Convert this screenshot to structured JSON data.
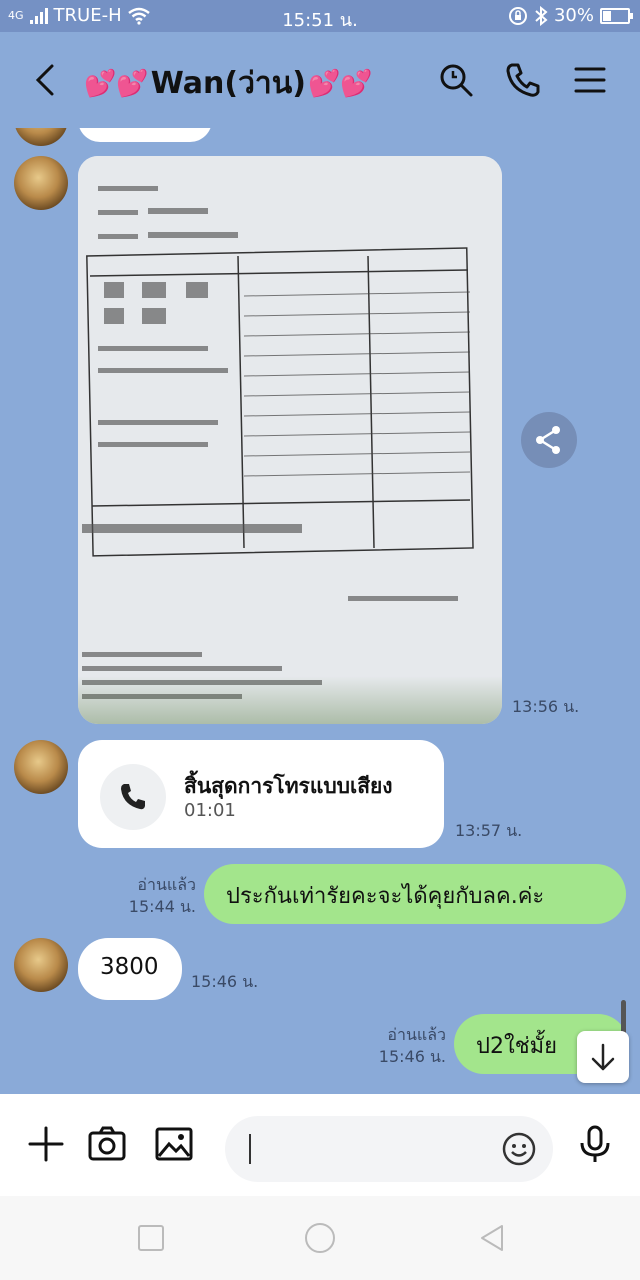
{
  "status_bar": {
    "network": "4G",
    "carrier": "TRUE-H",
    "time": "15:51 น.",
    "battery": "30%"
  },
  "header": {
    "contact_name": "Wan(ว่าน)",
    "back_icon": "chevron-left-icon",
    "search_icon": "search-icon",
    "call_icon": "phone-icon",
    "menu_icon": "menu-icon",
    "heart_color": "#e8508c"
  },
  "messages": [
    {
      "type": "image",
      "sender": "contact",
      "content": "photo of a car purchase commission document",
      "time": "13:56 น."
    },
    {
      "type": "call",
      "sender": "contact",
      "title": "สิ้นสุดการโทรแบบเสียง",
      "duration": "01:01",
      "time": "13:57 น."
    },
    {
      "type": "text",
      "sender": "me",
      "text": "ประกันเท่ารัยคะจะได้คุยกับลค.ค่ะ",
      "read_label": "อ่านแล้ว",
      "time": "15:44 น."
    },
    {
      "type": "text",
      "sender": "contact",
      "text": "3800",
      "time": "15:46 น."
    },
    {
      "type": "text",
      "sender": "me",
      "text": "ป2ใช่มั้ย",
      "read_label": "อ่านแล้ว",
      "time": "15:46 น."
    }
  ],
  "input": {
    "placeholder": "",
    "plus_icon": "plus-icon",
    "camera_icon": "camera-icon",
    "gallery_icon": "image-icon",
    "emoji_icon": "emoji-icon",
    "mic_icon": "microphone-icon"
  },
  "colors": {
    "chat_background": "#8aaad8",
    "my_bubble": "#a3e58c",
    "contact_bubble": "#ffffff"
  }
}
